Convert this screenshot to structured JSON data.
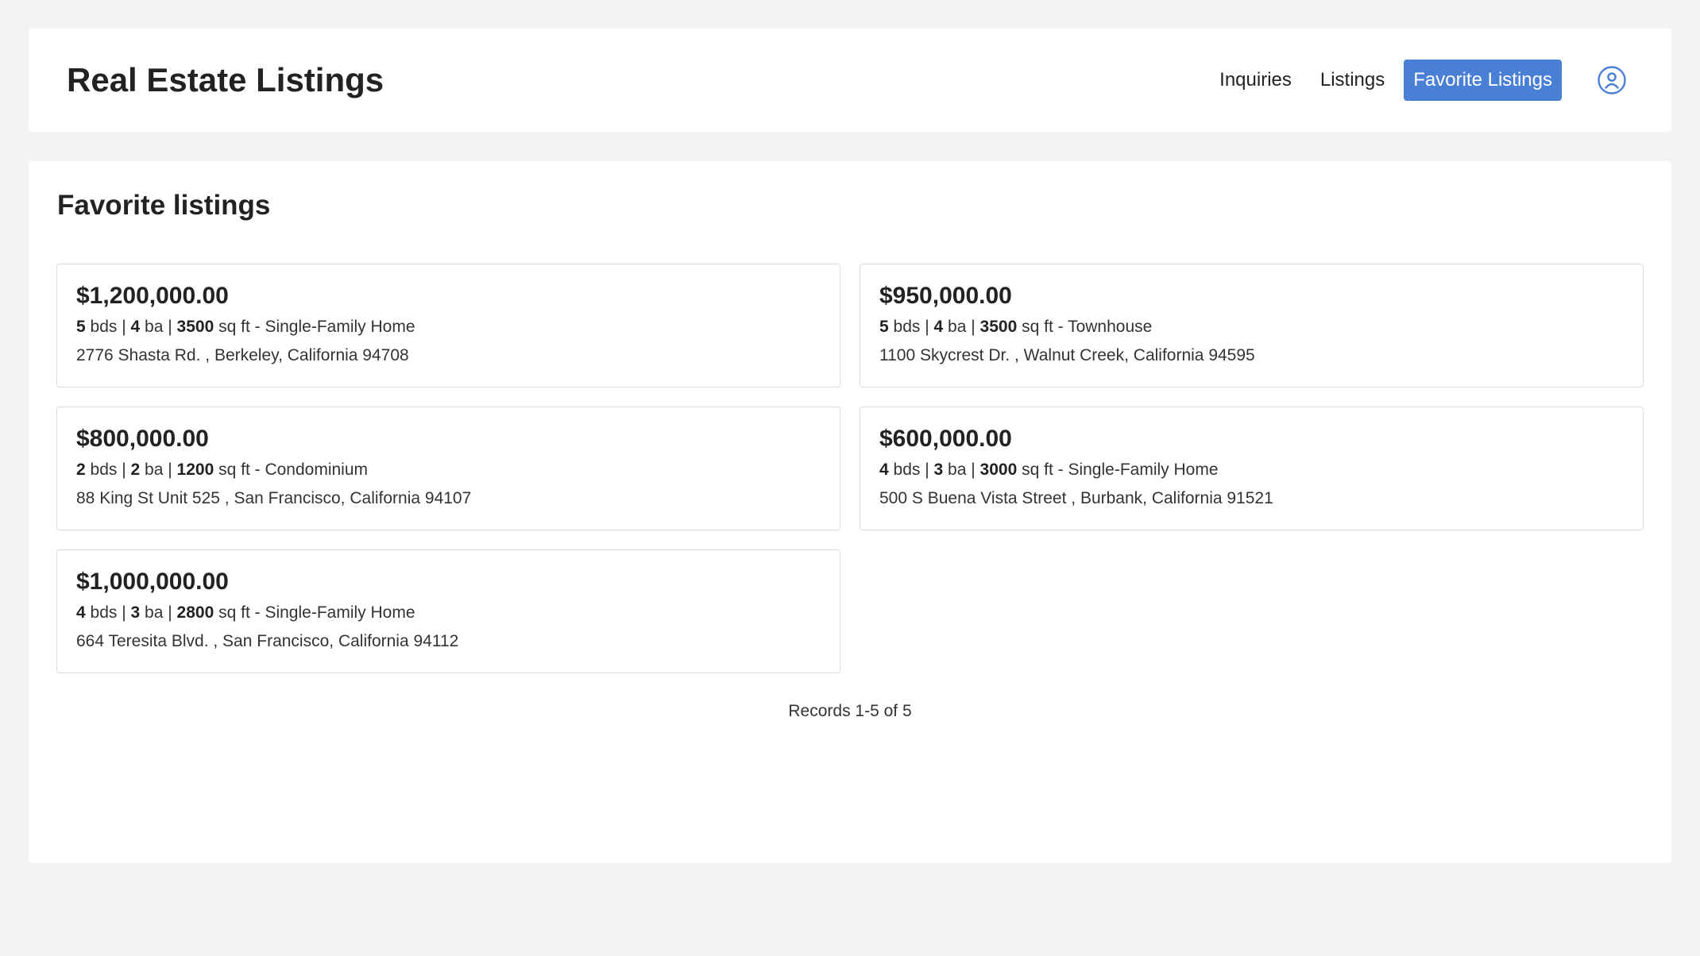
{
  "header": {
    "title": "Real Estate Listings",
    "nav": [
      {
        "label": "Inquiries"
      },
      {
        "label": "Listings"
      },
      {
        "label": "Favorite Listings"
      }
    ]
  },
  "main": {
    "title": "Favorite listings",
    "listings": [
      {
        "price": "$1,200,000.00",
        "beds": "5",
        "beds_unit": "bds",
        "baths": "4",
        "baths_unit": "ba",
        "sqft": "3500",
        "sqft_unit": "sq ft",
        "type": "Single-Family Home",
        "address": "2776 Shasta Rd. , Berkeley, California 94708"
      },
      {
        "price": "$950,000.00",
        "beds": "5",
        "beds_unit": "bds",
        "baths": "4",
        "baths_unit": "ba",
        "sqft": "3500",
        "sqft_unit": "sq ft",
        "type": "Townhouse",
        "address": "1100 Skycrest Dr. , Walnut Creek, California 94595"
      },
      {
        "price": "$800,000.00",
        "beds": "2",
        "beds_unit": "bds",
        "baths": "2",
        "baths_unit": "ba",
        "sqft": "1200",
        "sqft_unit": "sq ft",
        "type": "Condominium",
        "address": "88 King St Unit 525 , San Francisco, California 94107"
      },
      {
        "price": "$600,000.00",
        "beds": "4",
        "beds_unit": "bds",
        "baths": "3",
        "baths_unit": "ba",
        "sqft": "3000",
        "sqft_unit": "sq ft",
        "type": "Single-Family Home",
        "address": "500 S Buena Vista Street , Burbank, California 91521"
      },
      {
        "price": "$1,000,000.00",
        "beds": "4",
        "beds_unit": "bds",
        "baths": "3",
        "baths_unit": "ba",
        "sqft": "2800",
        "sqft_unit": "sq ft",
        "type": "Single-Family Home",
        "address": "664 Teresita Blvd. , San Francisco, California 94112"
      }
    ],
    "records_text": "Records 1-5 of 5"
  },
  "icons": {
    "user": "user-circle-icon"
  },
  "colors": {
    "accent": "#4a7fd6",
    "background": "#f3f3f3"
  }
}
